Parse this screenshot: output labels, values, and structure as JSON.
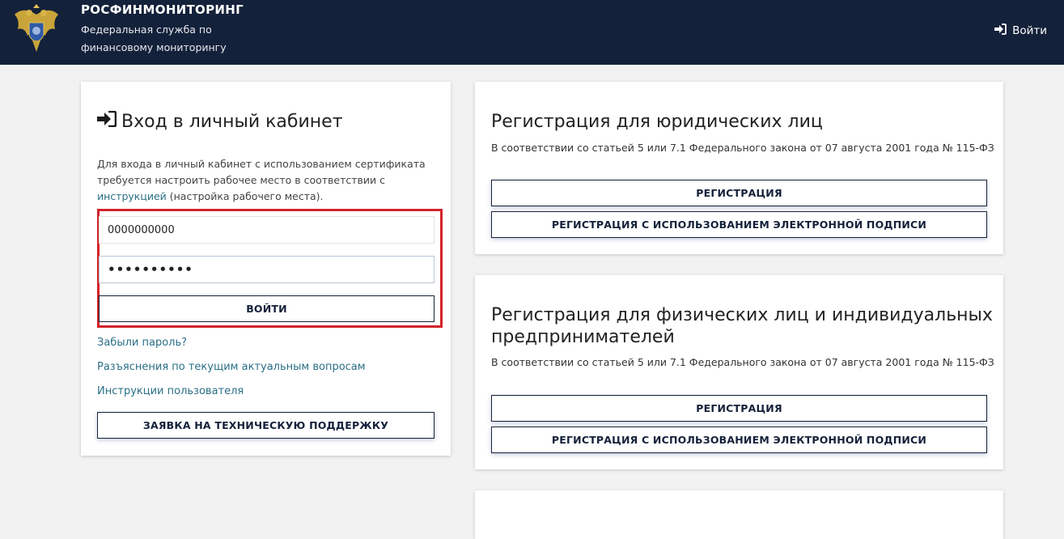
{
  "header": {
    "title": "РОСФИНМОНИТОРИНГ",
    "subtitle_line1": "Федеральная служба по",
    "subtitle_line2": "финансовому мониторингу",
    "login_link": "Войти",
    "logo_icon": "double-headed-eagle-emblem",
    "background": "#14213a"
  },
  "login": {
    "title": "Вход в личный кабинет",
    "desc_part1": "Для входа в личный кабинет с использованием сертификата требуется настроить рабочее место в соответствии с ",
    "desc_link": "инструкцией",
    "desc_part2": " (настройка рабочего места).",
    "login_value": "0000000000",
    "password_value": "••••••••••",
    "submit_label": "ВОЙТИ",
    "forgot_link": "Забыли пароль?",
    "explanations_link": "Разъяснения по текущим актуальным вопросам",
    "instructions_link": "Инструкции пользователя",
    "support_button": "ЗАЯВКА НА ТЕХНИЧЕСКУЮ ПОДДЕРЖКУ",
    "highlight_color": "#d2232a"
  },
  "legal": {
    "title": "Регистрация для юридических лиц",
    "law": "В соответствии со статьей 5 или 7.1 Федерального закона от 07 августа 2001 года № 115-ФЗ",
    "register_button": "РЕГИСТРАЦИЯ",
    "register_sign_button": "РЕГИСТРАЦИЯ С ИСПОЛЬЗОВАНИЕМ ЭЛЕКТРОННОЙ ПОДПИСИ"
  },
  "physical": {
    "title_line1": "Регистрация для физических лиц и индивидуальных",
    "title_line2": "предпринимателей",
    "law": "В соответствии со статьей 5 или 7.1 Федерального закона от 07 августа 2001 года № 115-ФЗ",
    "register_button": "РЕГИСТРАЦИЯ",
    "register_sign_button": "РЕГИСТРАЦИЯ С ИСПОЛЬЗОВАНИЕМ ЭЛЕКТРОННОЙ ПОДПИСИ"
  }
}
